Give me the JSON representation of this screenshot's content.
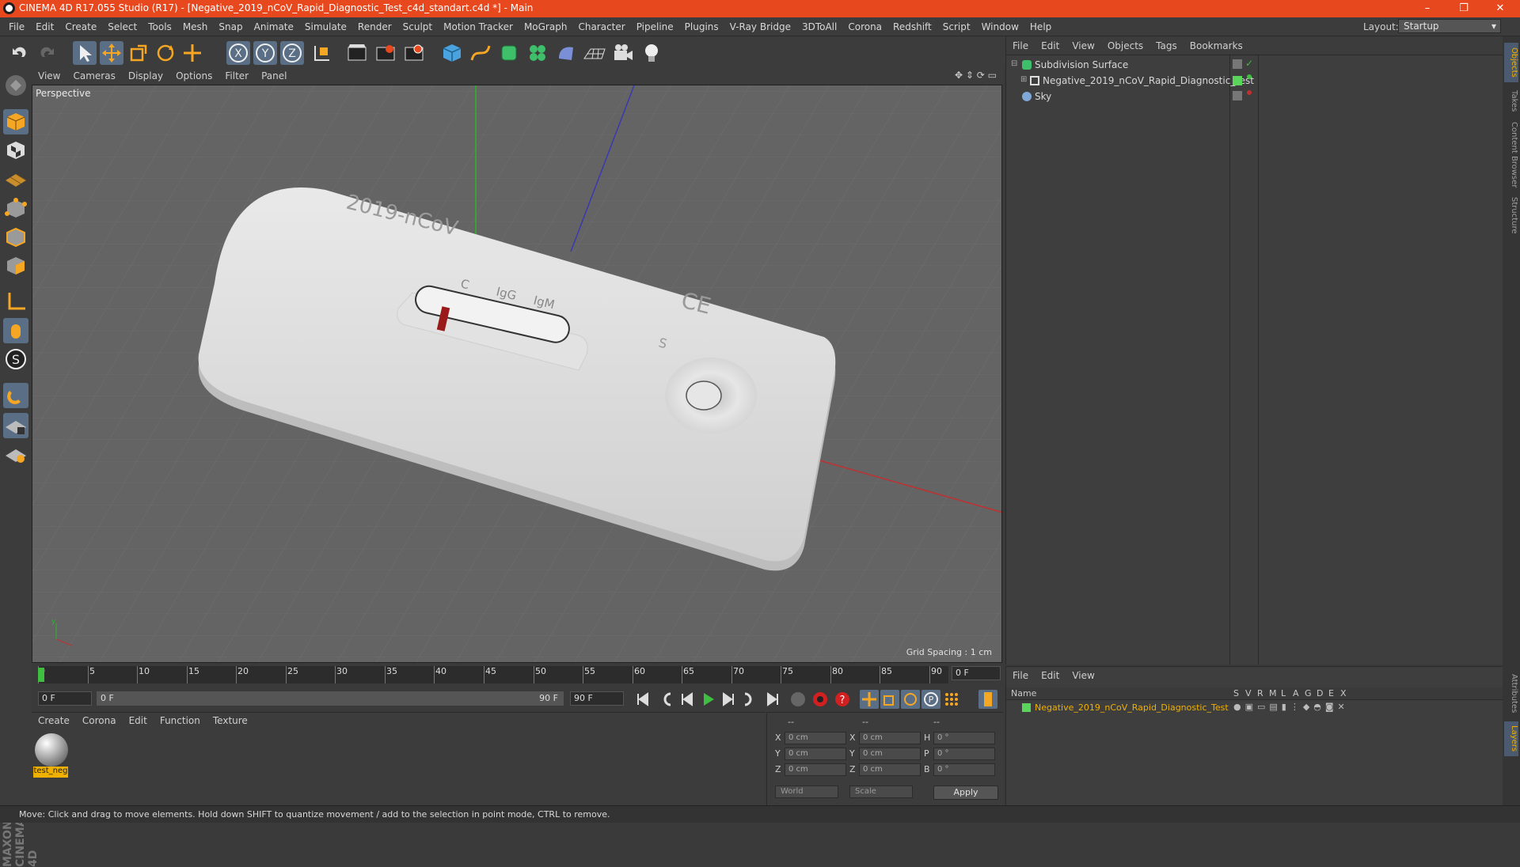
{
  "titlebar": {
    "title": "CINEMA 4D R17.055 Studio (R17) - [Negative_2019_nCoV_Rapid_Diagnostic_Test_c4d_standart.c4d *] - Main",
    "minimize": "–",
    "restore": "❐",
    "close": "✕"
  },
  "menubar": {
    "items": [
      "File",
      "Edit",
      "Create",
      "Select",
      "Tools",
      "Mesh",
      "Snap",
      "Animate",
      "Simulate",
      "Render",
      "Sculpt",
      "Motion Tracker",
      "MoGraph",
      "Character",
      "Pipeline",
      "Plugins",
      "V-Ray Bridge",
      "3DToAll",
      "Corona",
      "Redshift",
      "Script",
      "Window",
      "Help"
    ],
    "layout_label": "Layout:",
    "layout_value": "Startup"
  },
  "viewport": {
    "menu": [
      "View",
      "Cameras",
      "Display",
      "Options",
      "Filter",
      "Panel"
    ],
    "label": "Perspective",
    "grid_spacing": "Grid Spacing : 1 cm",
    "model_text_top": "2019-nCoV",
    "model_text_c": "C",
    "model_text_igg": "IgG",
    "model_text_igm": "IgM",
    "model_text_ce": "CE",
    "model_text_s": "S"
  },
  "timeline": {
    "ticks": [
      "0",
      "5",
      "10",
      "15",
      "20",
      "25",
      "30",
      "35",
      "40",
      "45",
      "50",
      "55",
      "60",
      "65",
      "70",
      "75",
      "80",
      "85",
      "90"
    ],
    "current_frame": "0 F",
    "start": "0 F",
    "range_start": "0 F",
    "range_end": "90 F",
    "end": "90 F"
  },
  "material_manager": {
    "menu": [
      "Create",
      "Corona",
      "Edit",
      "Function",
      "Texture"
    ],
    "material_name": "test_neg"
  },
  "coordinates": {
    "dashes": [
      "--",
      "--",
      "--"
    ],
    "rows": [
      {
        "a": "X",
        "av": "0 cm",
        "b": "X",
        "bv": "0 cm",
        "c": "H",
        "cv": "0 °"
      },
      {
        "a": "Y",
        "av": "0 cm",
        "b": "Y",
        "bv": "0 cm",
        "c": "P",
        "cv": "0 °"
      },
      {
        "a": "Z",
        "av": "0 cm",
        "b": "Z",
        "bv": "0 cm",
        "c": "B",
        "cv": "0 °"
      }
    ],
    "mode1": "World",
    "mode2": "Scale",
    "apply": "Apply"
  },
  "object_manager": {
    "menu": [
      "File",
      "Edit",
      "View",
      "Objects",
      "Tags",
      "Bookmarks"
    ],
    "objects": [
      "Subdivision Surface",
      "Negative_2019_nCoV_Rapid_Diagnostic_Test",
      "Sky"
    ]
  },
  "layer_manager": {
    "menu": [
      "File",
      "Edit",
      "View"
    ],
    "col_name": "Name",
    "cols": [
      "S",
      "V",
      "R",
      "M",
      "L",
      "A",
      "G",
      "D",
      "E",
      "X"
    ],
    "layer_name": "Negative_2019_nCoV_Rapid_Diagnostic_Test"
  },
  "right_tabs": [
    "Objects",
    "Takes",
    "Content Browser",
    "Structure"
  ],
  "right_tabs_bottom": [
    "Attributes",
    "Layers"
  ],
  "branding": "MAXON CINEMA 4D",
  "statusbar": {
    "text": "Move: Click and drag to move elements. Hold down SHIFT to quantize movement / add to the selection in point mode, CTRL to remove."
  },
  "colors": {
    "title": "#e8481e",
    "viewport": "#646464",
    "active": "#5a6e86",
    "accent": "#f0b000"
  }
}
